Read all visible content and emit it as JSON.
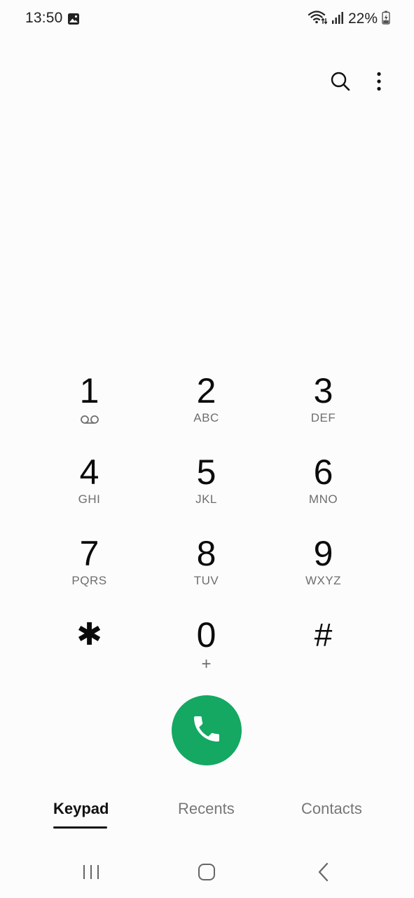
{
  "status_bar": {
    "time": "13:50",
    "battery_percent": "22%",
    "icons": [
      "gallery-icon",
      "wifi-icon",
      "signal-icon",
      "battery-charging-icon"
    ]
  },
  "toolbar": {
    "icons": [
      "search-icon",
      "more-options-icon"
    ]
  },
  "keypad": {
    "keys": [
      {
        "digit": "1",
        "letters": "",
        "sub_icon": "voicemail-icon"
      },
      {
        "digit": "2",
        "letters": "ABC"
      },
      {
        "digit": "3",
        "letters": "DEF"
      },
      {
        "digit": "4",
        "letters": "GHI"
      },
      {
        "digit": "5",
        "letters": "JKL"
      },
      {
        "digit": "6",
        "letters": "MNO"
      },
      {
        "digit": "7",
        "letters": "PQRS"
      },
      {
        "digit": "8",
        "letters": "TUV"
      },
      {
        "digit": "9",
        "letters": "WXYZ"
      },
      {
        "digit": "*",
        "letters": "",
        "glyph": "✱"
      },
      {
        "digit": "0",
        "letters": "+"
      },
      {
        "digit": "#",
        "letters": ""
      }
    ]
  },
  "call_button": {
    "icon": "phone-icon",
    "color": "#14a863"
  },
  "tabs": {
    "items": [
      {
        "label": "Keypad",
        "active": true
      },
      {
        "label": "Recents",
        "active": false
      },
      {
        "label": "Contacts",
        "active": false
      }
    ]
  },
  "navbar": {
    "icons": [
      "recent-apps-icon",
      "home-icon",
      "back-icon"
    ]
  }
}
